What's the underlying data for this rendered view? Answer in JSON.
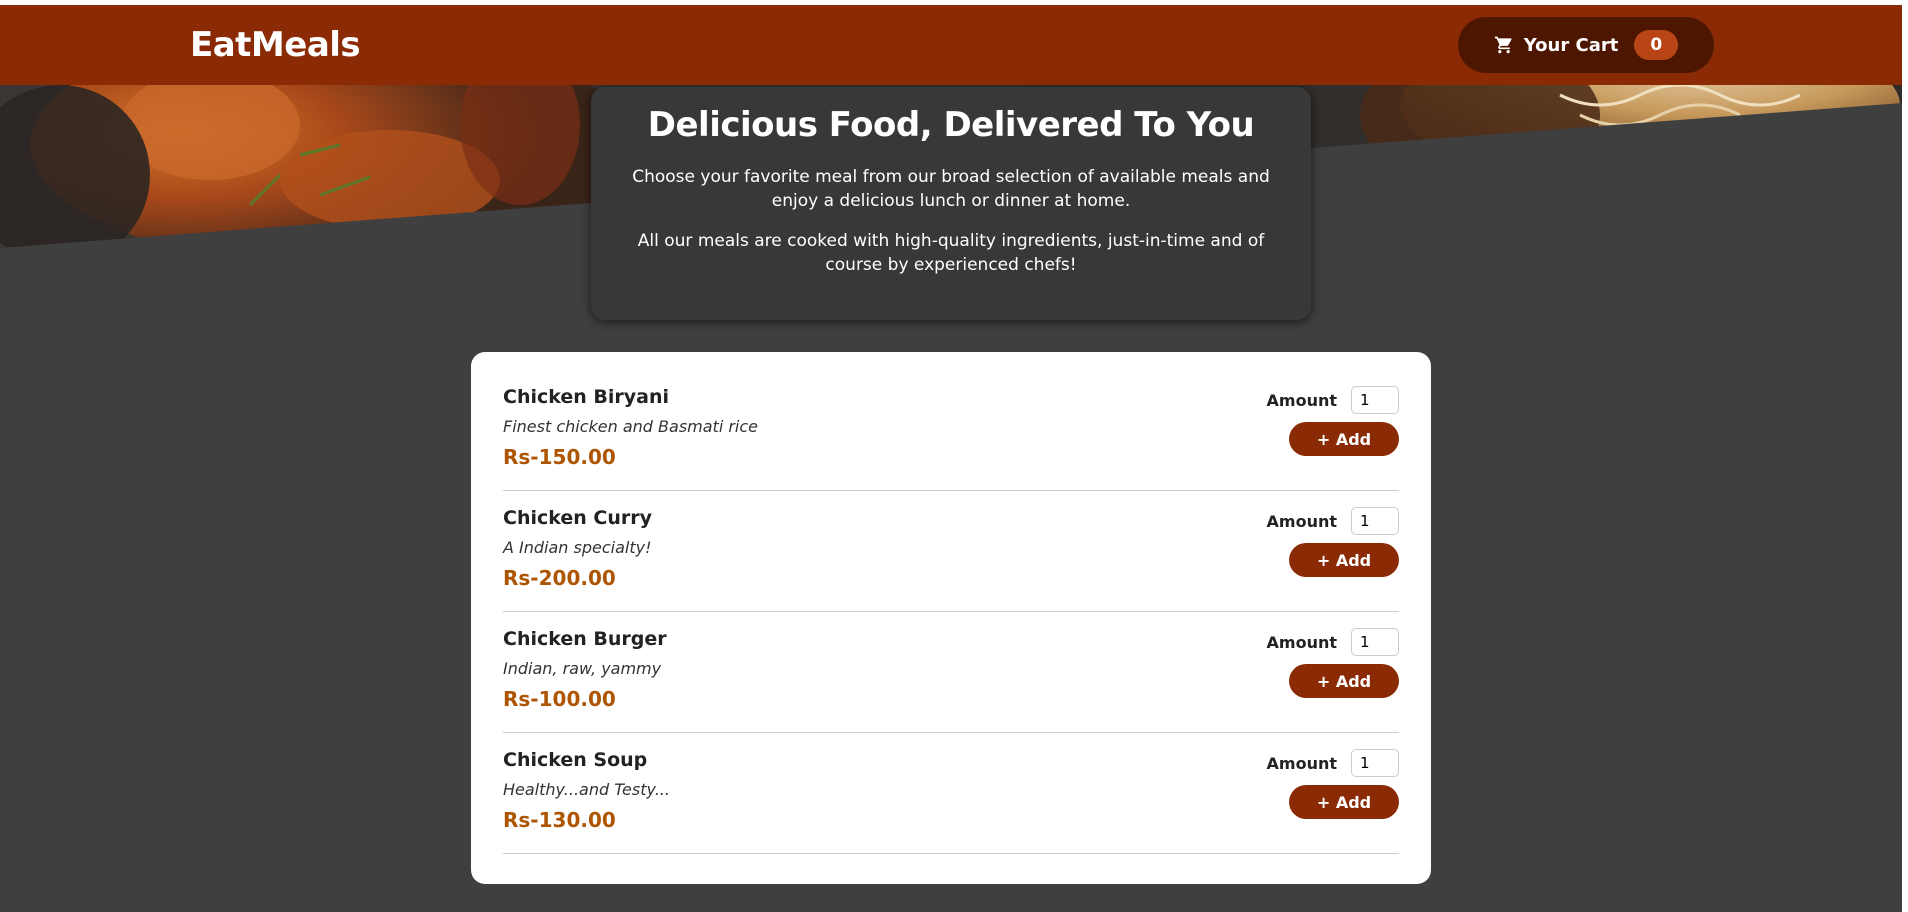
{
  "header": {
    "logo": "EatMeals",
    "cart_label": "Your Cart",
    "cart_count": "0"
  },
  "summary": {
    "title": "Delicious Food, Delivered To You",
    "paragraph1": "Choose your favorite meal from our broad selection of available meals and enjoy a delicious lunch or dinner at home.",
    "paragraph2": "All our meals are cooked with high-quality ingredients, just-in-time and of course by experienced chefs!"
  },
  "meals": [
    {
      "name": "Chicken Biryani",
      "description": "Finest chicken and Basmati rice",
      "price": "Rs-150.00",
      "amount_label": "Amount",
      "amount": "1",
      "add_label": "+ Add"
    },
    {
      "name": "Chicken Curry",
      "description": "A Indian specialty!",
      "price": "Rs-200.00",
      "amount_label": "Amount",
      "amount": "1",
      "add_label": "+ Add"
    },
    {
      "name": "Chicken Burger",
      "description": "Indian, raw, yammy",
      "price": "Rs-100.00",
      "amount_label": "Amount",
      "amount": "1",
      "add_label": "+ Add"
    },
    {
      "name": "Chicken Soup",
      "description": "Healthy...and Testy...",
      "price": "Rs-130.00",
      "amount_label": "Amount",
      "amount": "1",
      "add_label": "+ Add"
    }
  ],
  "colors": {
    "header": "#8a2b06",
    "cart_button": "#4d1601",
    "cart_badge": "#b94517",
    "price": "#ad5502",
    "background": "#3f3f3f"
  },
  "icons": {
    "cart": "cart-icon"
  }
}
